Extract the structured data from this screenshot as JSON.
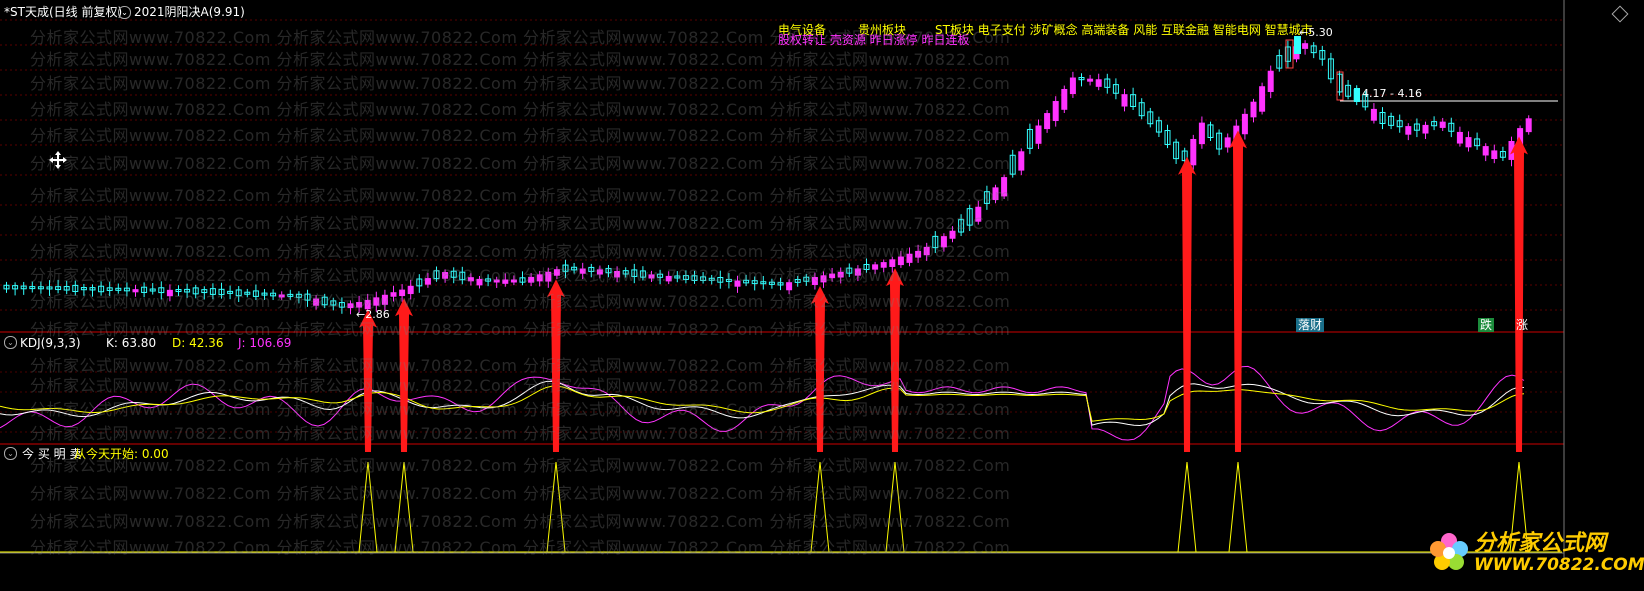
{
  "header": {
    "stock_title": "*ST天成(日线 前复权)",
    "indicator_icon": "chevron-down-icon",
    "indicator_label": "2021阴阳决A(9.91)"
  },
  "tags_line1": {
    "a": "电气设备",
    "b": "贵州板块",
    "c": "ST板块 电子支付 涉矿概念 高端装备 风能 互联金融 智能电网 智慧城市"
  },
  "tags_line2": "股权转让 壳资源 昨日涨停 昨日连板",
  "price_labels": {
    "high": "5.30",
    "range": "4.17 - 4.16",
    "low": "2.86"
  },
  "main_badges": {
    "b1": "落财",
    "b2": "跌",
    "b3": "涨"
  },
  "kdj": {
    "name": "KDJ(9,3,3)",
    "k": "K: 63.80",
    "d": "D: 42.36",
    "j": "J: 106.69"
  },
  "signal_panel": {
    "name": "今 买 明 卖",
    "text": "从今天开始: 0.00"
  },
  "watermark": "分析家公式网www.70822.Com",
  "logo": {
    "title": "分析家公式网",
    "url": "WWW.70822.COM"
  },
  "colors": {
    "up": "#ff33ff",
    "down": "#33ffff",
    "k_line": "#ffffff",
    "d_line": "#ffff00",
    "j_line": "#ff33ff",
    "arrow": "#ff1a1a",
    "signal": "#ffff00",
    "divider": "#cc0000"
  },
  "signal_points": [
    368,
    404,
    556,
    820,
    895,
    1187,
    1238,
    1519
  ]
}
